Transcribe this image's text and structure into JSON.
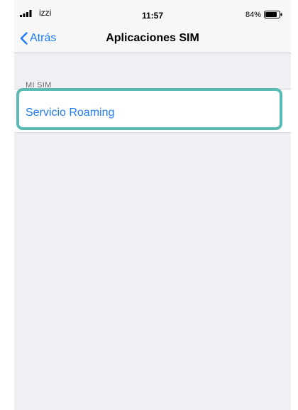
{
  "status_bar": {
    "carrier": "izzi",
    "time": "11:57",
    "battery_percent": "84%"
  },
  "nav": {
    "back_label": "Atrás",
    "title": "Aplicaciones SIM"
  },
  "section": {
    "header": "MI SIM",
    "items": [
      {
        "label": "Servicio Roaming"
      }
    ]
  },
  "colors": {
    "accent": "#1e7cf6",
    "highlight": "#5bbab3",
    "background": "#efeff4"
  },
  "icons": {
    "signal": "signal-bars-icon",
    "battery": "battery-icon",
    "back": "chevron-left-icon"
  }
}
